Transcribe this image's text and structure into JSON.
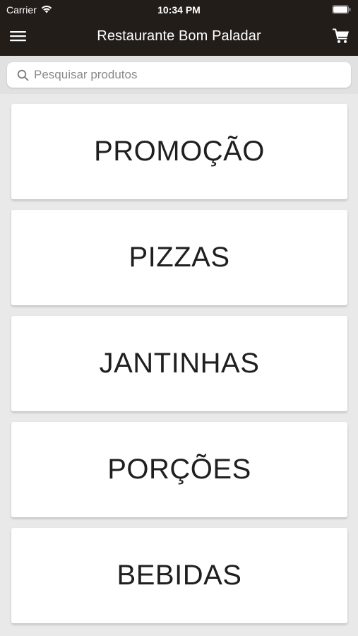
{
  "status_bar": {
    "carrier": "Carrier",
    "time": "10:34 PM"
  },
  "toolbar": {
    "title": "Restaurante Bom Paladar",
    "menu_icon": "hamburger-menu-icon",
    "cart_icon": "cart-icon"
  },
  "search": {
    "placeholder": "Pesquisar produtos",
    "value": ""
  },
  "categories": [
    {
      "label": "PROMOÇÃO"
    },
    {
      "label": "PIZZAS"
    },
    {
      "label": "JANTINHAS"
    },
    {
      "label": "PORÇÕES"
    },
    {
      "label": "BEBIDAS"
    }
  ],
  "colors": {
    "header_bg": "#231d1a",
    "page_bg": "#e9e9e9",
    "card_bg": "#ffffff",
    "text": "#1f1f1f"
  }
}
